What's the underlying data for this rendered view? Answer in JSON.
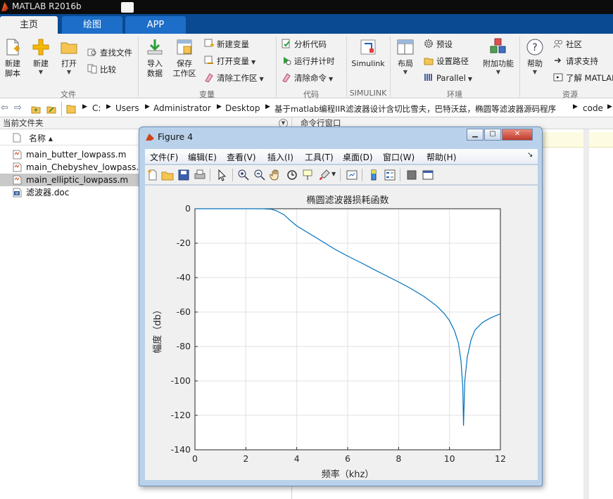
{
  "app": {
    "title": "MATLAB R2016b"
  },
  "tabs": [
    {
      "label": "主页",
      "active": true
    },
    {
      "label": "绘图",
      "active": false
    },
    {
      "label": "APP",
      "active": false
    }
  ],
  "ribbon": {
    "file": {
      "new_script": "新建\n脚本",
      "new_script_l1": "新建",
      "new_script_l2": "脚本",
      "new": "新建",
      "open": "打开",
      "find_files": "查找文件",
      "compare": "比较",
      "section": "文件"
    },
    "variable": {
      "import_l1": "导入",
      "import_l2": "数据",
      "save_l1": "保存",
      "save_l2": "工作区",
      "new_variable": "新建变量",
      "open_variable": "打开变量",
      "clear_workspace": "清除工作区",
      "section": "变量"
    },
    "code": {
      "analyze": "分析代码",
      "run_and_time": "运行并计时",
      "clear_commands": "清除命令",
      "section": "代码"
    },
    "simulink": {
      "label": "Simulink",
      "section": "SIMULINK"
    },
    "environment": {
      "layout": "布局",
      "preferences": "预设",
      "set_path": "设置路径",
      "parallel": "Parallel",
      "addons": "附加功能",
      "section": "环境"
    },
    "resources": {
      "help": "帮助",
      "community": "社区",
      "request_support": "请求支持",
      "learn_matlab": "了解 MATLAB",
      "section": "资源"
    }
  },
  "address": {
    "crumbs": [
      "C:",
      "Users",
      "Administrator",
      "Desktop",
      "基于matlab编程IIR滤波器设计含切比雪夫，巴特沃兹，椭圆等滤波器源码程序",
      "code"
    ]
  },
  "current_folder": {
    "title": "当前文件夹",
    "column_name": "名称 ▴",
    "files": [
      {
        "name": "main_butter_lowpass.m",
        "type": "m",
        "selected": false
      },
      {
        "name": "main_Chebyshev_lowpass.m",
        "type": "m",
        "selected": false
      },
      {
        "name": "main_elliptic_lowpass.m",
        "type": "m",
        "selected": true
      },
      {
        "name": "滤波器.doc",
        "type": "doc",
        "selected": false
      }
    ]
  },
  "command_window": {
    "title": "命令行窗口"
  },
  "figure": {
    "title": "Figure 4",
    "menus": [
      "文件(F)",
      "编辑(E)",
      "查看(V)",
      "插入(I)",
      "工具(T)",
      "桌面(D)",
      "窗口(W)",
      "帮助(H)"
    ]
  },
  "chart_data": {
    "type": "line",
    "title": "椭圆滤波器损耗函数",
    "xlabel": "频率（khz）",
    "ylabel": "幅度（db）",
    "xlim": [
      0,
      12
    ],
    "ylim": [
      -140,
      0
    ],
    "xticks": [
      0,
      2,
      4,
      6,
      8,
      10,
      12
    ],
    "yticks": [
      0,
      -20,
      -40,
      -60,
      -80,
      -100,
      -120,
      -140
    ],
    "grid": true,
    "series": [
      {
        "color": "#0072bd",
        "x": [
          0,
          1,
          2,
          2.6,
          3.0,
          3.2,
          3.5,
          3.8,
          4.0,
          4.5,
          5.0,
          5.5,
          6.0,
          6.5,
          7.0,
          7.5,
          8.0,
          8.5,
          9.0,
          9.5,
          9.8,
          10.0,
          10.2,
          10.35,
          10.45,
          10.52,
          10.55,
          10.6,
          10.7,
          10.85,
          11.0,
          11.3,
          11.6,
          12.0
        ],
        "y": [
          0,
          0,
          0,
          0,
          -0.3,
          -1.2,
          -3.5,
          -7.5,
          -10,
          -14.5,
          -19,
          -23.5,
          -27.5,
          -31.2,
          -35,
          -38.8,
          -42.5,
          -46.5,
          -51,
          -56.5,
          -61,
          -65,
          -71,
          -78,
          -88,
          -103,
          -126,
          -100,
          -86,
          -76,
          -70.5,
          -66,
          -63.5,
          -61
        ]
      }
    ]
  }
}
